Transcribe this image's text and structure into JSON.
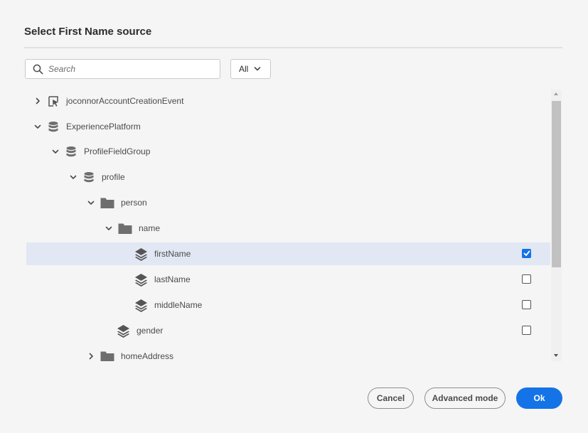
{
  "dialog": {
    "title": "Select First Name source"
  },
  "search": {
    "placeholder": "Search",
    "value": ""
  },
  "filter": {
    "selected": "All"
  },
  "tree": {
    "nodes": [
      {
        "label": "joconnorAccountCreationEvent",
        "icon": "event-icon",
        "toggle": "chevron-right-icon"
      },
      {
        "label": "ExperiencePlatform",
        "icon": "database-icon",
        "toggle": "chevron-down-icon"
      },
      {
        "label": "ProfileFieldGroup",
        "icon": "database-icon",
        "toggle": "chevron-down-icon"
      },
      {
        "label": "profile",
        "icon": "database-icon",
        "toggle": "chevron-down-icon"
      },
      {
        "label": "person",
        "icon": "folder-icon",
        "toggle": "chevron-down-icon"
      },
      {
        "label": "name",
        "icon": "folder-icon",
        "toggle": "chevron-down-icon"
      },
      {
        "label": "firstName",
        "icon": "field-layers-icon",
        "checked": true,
        "selected": true
      },
      {
        "label": "lastName",
        "icon": "field-layers-icon",
        "checked": false
      },
      {
        "label": "middleName",
        "icon": "field-layers-icon",
        "checked": false
      },
      {
        "label": "gender",
        "icon": "field-layers-icon",
        "checked": false
      },
      {
        "label": "homeAddress",
        "icon": "folder-icon",
        "toggle": "chevron-right-icon"
      }
    ]
  },
  "footer": {
    "cancel_label": "Cancel",
    "advanced_label": "Advanced mode",
    "ok_label": "Ok"
  },
  "colors": {
    "accent": "#1473e6",
    "selected_row": "#e1e7f3",
    "background": "#f5f5f5"
  }
}
